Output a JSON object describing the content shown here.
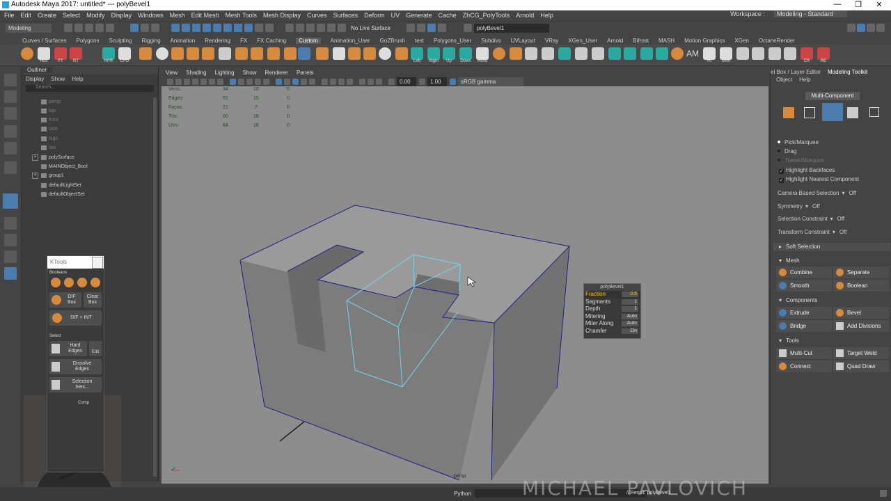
{
  "window": {
    "title": "Autodesk Maya 2017: untitled*   ---   polyBevel1"
  },
  "menubar": {
    "items": [
      "File",
      "Edit",
      "Create",
      "Select",
      "Modify",
      "Display",
      "Windows",
      "Mesh",
      "Edit Mesh",
      "Mesh Tools",
      "Mesh Display",
      "Curves",
      "Surfaces",
      "Deform",
      "UV",
      "Generate",
      "Cache",
      "ZhCG_PolyTools",
      "Arnold",
      "Help"
    ],
    "workspace_label": "Workspace :",
    "workspace_value": "Modeling - Standard"
  },
  "statusline": {
    "mode": "Modeling",
    "live_surface": "No Live Surface",
    "name_field": "polyBevel1"
  },
  "shelf": {
    "tabs": [
      "Curves / Surfaces",
      "Polygons",
      "Sculpting",
      "Rigging",
      "Animation",
      "Rendering",
      "FX",
      "FX Caching",
      "Custom",
      "Animation_User",
      "GoZBrush",
      "test",
      "Polygons_User",
      "Subdivs",
      "UVLayout",
      "VRay",
      "XGen_User",
      "Arnold",
      "Bifrost",
      "MASH",
      "Motion Graphics",
      "XGen",
      "OctaneRender"
    ],
    "active_tab": "Custom",
    "icon_labels": [
      "Hist",
      "FT",
      "RT",
      "HFR",
      "CPD",
      "Left",
      "Right",
      "Up",
      "Down",
      "Hshd",
      "AM",
      "HI",
      "MMI",
      "CR",
      "RE"
    ]
  },
  "outliner": {
    "tab": "Outliner",
    "menu": [
      "Display",
      "Show",
      "Help"
    ],
    "search_placeholder": "Search...",
    "items": [
      {
        "name": "persp",
        "dim": true
      },
      {
        "name": "top",
        "dim": true
      },
      {
        "name": "front",
        "dim": true
      },
      {
        "name": "side",
        "dim": true
      },
      {
        "name": "high",
        "dim": true
      },
      {
        "name": "low",
        "dim": true
      },
      {
        "name": "polySurface",
        "dim": false
      },
      {
        "name": "MAINObject_Bool",
        "dim": false
      },
      {
        "name": "group1",
        "dim": false
      },
      {
        "name": "defaultLightSet",
        "dim": false
      },
      {
        "name": "defaultObjectSet",
        "dim": false
      }
    ]
  },
  "ktools": {
    "title": "KTools",
    "booleans_label": "Booleans",
    "dif_box": "DIF Box",
    "clear_box": "Clear Box",
    "dif_int": "DIF + INT",
    "select_label": "Select",
    "hard_edges": "Hard Edges",
    "edit": "Edit",
    "dissolve_edges": "Dissolve Edges",
    "selection_sets": "Selection Sets...",
    "comp_label": "Comp"
  },
  "viewport": {
    "menu": [
      "View",
      "Shading",
      "Lighting",
      "Show",
      "Renderer",
      "Panels"
    ],
    "field1": "0.00",
    "field2": "1.00",
    "color_space": "sRGB gamma",
    "camera": "persp",
    "hud": [
      {
        "label": "Verts:",
        "a": "34",
        "b": "10",
        "c": "0"
      },
      {
        "label": "Edges:",
        "a": "51",
        "b": "15",
        "c": "0"
      },
      {
        "label": "Faces:",
        "a": "21",
        "b": "7",
        "c": "0"
      },
      {
        "label": "Tris:",
        "a": "60",
        "b": "16",
        "c": "0"
      },
      {
        "label": "UVs:",
        "a": "64",
        "b": "16",
        "c": "0"
      }
    ]
  },
  "polybevel": {
    "title": "polyBevel1",
    "rows": [
      {
        "label": "Fraction",
        "value": "0.5",
        "selected": true
      },
      {
        "label": "Segments",
        "value": "1",
        "selected": false
      },
      {
        "label": "Depth",
        "value": "1",
        "selected": false
      },
      {
        "label": "Mitering",
        "value": "Auto",
        "selected": false
      },
      {
        "label": "Miter Along",
        "value": "Auto",
        "selected": false
      },
      {
        "label": "Chamfer",
        "value": "On",
        "selected": false
      }
    ]
  },
  "toolkit": {
    "tab_left": "el Box / Layer Editor",
    "tab_right": "Modeling Toolkit",
    "menu": [
      "Object",
      "Help"
    ],
    "mode": "Multi-Component",
    "pick_marquee": "Pick/Marquee",
    "drag": "Drag",
    "tweak_marquee": "Tweak/Marquee",
    "highlight_backfaces": "Highlight Backfaces",
    "highlight_nearest": "Highlight Nearest Component",
    "camera_based": "Camera Based Selection",
    "camera_based_val": "Off",
    "symmetry": "Symmetry",
    "symmetry_val": "Off",
    "sel_constraint": "Selection Constraint",
    "sel_constraint_val": "Off",
    "transform_constraint": "Transform Constraint",
    "transform_constraint_val": "Off",
    "soft_selection": "Soft Selection",
    "mesh_label": "Mesh",
    "combine": "Combine",
    "separate": "Separate",
    "smooth": "Smooth",
    "boolean": "Boolean",
    "components_label": "Components",
    "extrude": "Extrude",
    "bevel": "Bevel",
    "bridge": "Bridge",
    "add_divisions": "Add Divisions",
    "tools_label": "Tools",
    "multi_cut": "Multi-Cut",
    "target_weld": "Target Weld",
    "connect": "Connect",
    "quad_draw": "Quad Draw"
  },
  "bottombar": {
    "language": "Python",
    "result": "// Result: polyBevel1"
  },
  "watermark": "MICHAEL PAVLOVICH"
}
